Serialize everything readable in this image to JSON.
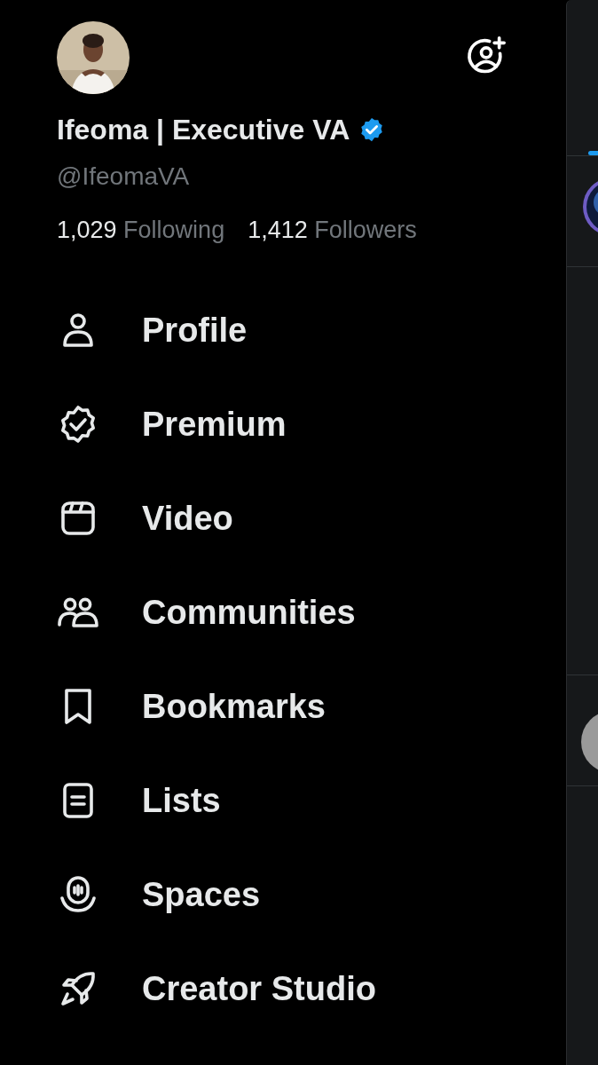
{
  "profile": {
    "name": "Ifeoma | Executive VA",
    "verified": true,
    "handle": "@IfeomaVA",
    "following_count": "1,029",
    "following_label": "Following",
    "followers_count": "1,412",
    "followers_label": "Followers"
  },
  "menu": [
    {
      "label": "Profile"
    },
    {
      "label": "Premium"
    },
    {
      "label": "Video"
    },
    {
      "label": "Communities"
    },
    {
      "label": "Bookmarks"
    },
    {
      "label": "Lists"
    },
    {
      "label": "Spaces"
    },
    {
      "label": "Creator Studio"
    }
  ]
}
